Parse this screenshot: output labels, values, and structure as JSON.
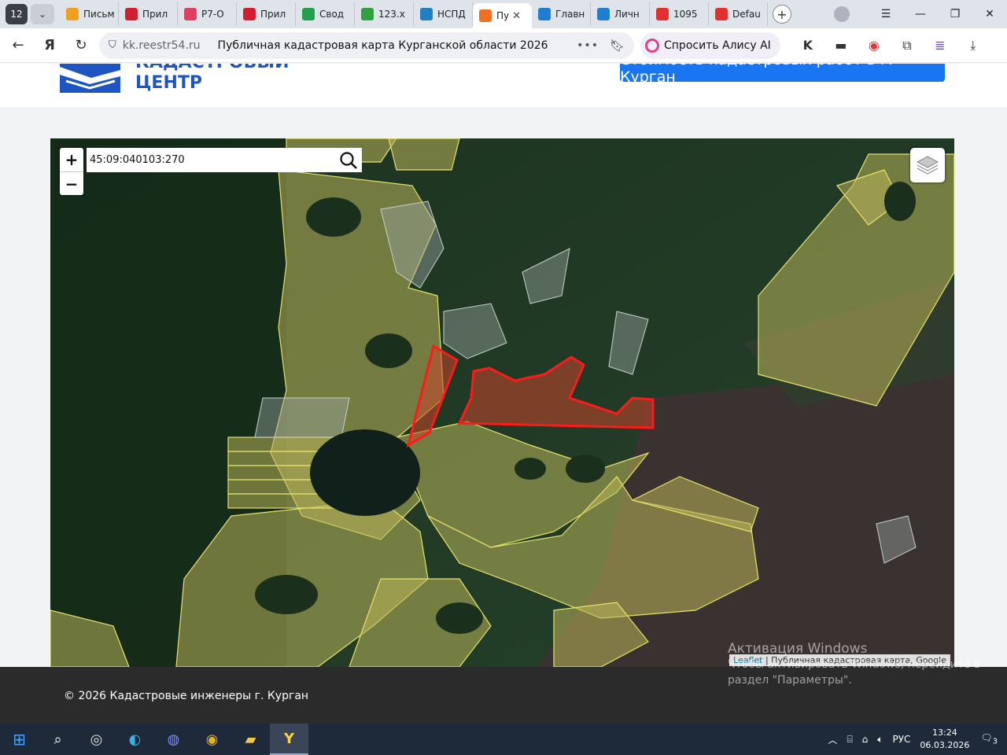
{
  "browser": {
    "tab_count": "12",
    "tabs": [
      {
        "label": "Письм",
        "color": "#f0a020"
      },
      {
        "label": "Прил",
        "color": "#d02030"
      },
      {
        "label": "Р7-О",
        "color": "#e04060"
      },
      {
        "label": "Прил",
        "color": "#d02030"
      },
      {
        "label": "Свод",
        "color": "#20a050"
      },
      {
        "label": "123.x",
        "color": "#30a040"
      },
      {
        "label": "НСПД",
        "color": "#2080c0"
      },
      {
        "label": "Пу",
        "color": "#f07020",
        "active": true
      },
      {
        "label": "Главн",
        "color": "#1e7fd0"
      },
      {
        "label": "Личн",
        "color": "#1e7fd0"
      },
      {
        "label": "1095",
        "color": "#e03030"
      },
      {
        "label": "Defau",
        "color": "#e03030"
      }
    ],
    "domain": "kk.reestr54.ru",
    "page_title": "Публичная кадастровая карта Курганской области 2026",
    "alice_label": "Спросить Алису AI"
  },
  "header": {
    "logo_line1": "КАДАСТРОВЫЙ",
    "logo_line2": "ЦЕНТР",
    "cta_label": "Стоимость кадастровых работ в г. Курган"
  },
  "map": {
    "search_value": "45:09:040103:270",
    "zoom_in": "+",
    "zoom_out": "−",
    "attribution_link": "Leaflet",
    "attribution_text": " | Публичная кадастровая карта, Google"
  },
  "footer": {
    "copyright": "© 2026 Кадастровые инженеры г. Курган"
  },
  "watermark": {
    "line1": "Активация Windows",
    "line2": "Чтобы активировать Windows, перейдите в",
    "line3": "раздел \"Параметры\"."
  },
  "taskbar": {
    "lang": "РУС",
    "time": "13:24",
    "date": "06.03.2026",
    "notifications": "3"
  }
}
